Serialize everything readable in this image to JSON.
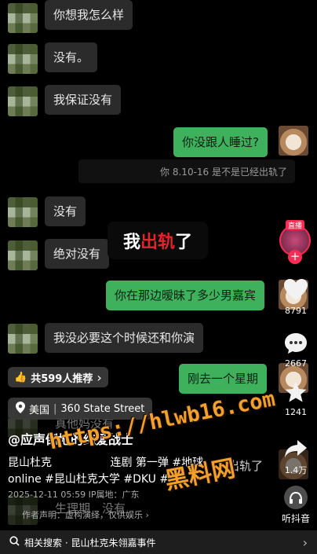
{
  "chat": {
    "m1": "你想我怎么样",
    "m2": "没有。",
    "m3": "我保证没有",
    "m4": "你没跟人睡过?",
    "m5": "你 8.10-16 是不是已经出轨了",
    "m6": "没有",
    "m7": "绝对没有",
    "m8": "你在那边暧昧了多少男嘉宾",
    "m9": "我没必要这个时候还和你演",
    "m10": "刚去一个星期",
    "m11": "真他妈没有",
    "m12": "出轨了",
    "m13": "生理期　没有"
  },
  "caption": {
    "pre": "我",
    "red": "出轨",
    "post": "了"
  },
  "right_bar": {
    "live_label": "直播",
    "like_count": "8791",
    "comment_count": "2667",
    "fav_count": "1241",
    "share_count": "1.4万",
    "listen_label": "听抖音"
  },
  "recommend": {
    "label": "共599人推荐",
    "arrow": "›"
  },
  "location": {
    "country": "美国",
    "address": "360 State Street"
  },
  "author": "@应声倒地的纯爱战士",
  "description": {
    "line1": "昆山杜克　　　　　 连剧 第一弹 #地球",
    "line2": "online #昆山杜克大学 #DKU #恥",
    "meta": "2025-12-11 05:59  IP属地：广东",
    "disclaimer": "作者声明：虚构演绎，仅供娱乐 ›"
  },
  "watermark": {
    "line1": "https://hlwb16.com",
    "line2": "黑料网"
  },
  "bottom_bar": {
    "label": "相关搜索 · 昆山杜克朱翎嘉事件",
    "arrow": "›"
  },
  "colors": {
    "accent_green": "#3fb15d",
    "caption_red": "#e0262b",
    "live_pink": "#fe2c55",
    "watermark": "#f3a02a"
  }
}
